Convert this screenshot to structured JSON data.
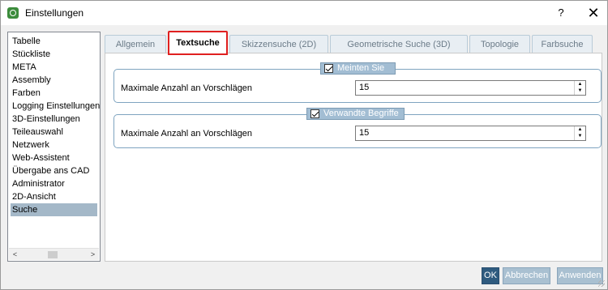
{
  "window": {
    "title": "Einstellungen",
    "help_label": "?",
    "close_label": "✕"
  },
  "sidebar": {
    "items": [
      {
        "label": "Tabelle"
      },
      {
        "label": "Stückliste"
      },
      {
        "label": "META"
      },
      {
        "label": "Assembly"
      },
      {
        "label": "Farben"
      },
      {
        "label": "Logging Einstellungen"
      },
      {
        "label": "3D-Einstellungen"
      },
      {
        "label": "Teileauswahl"
      },
      {
        "label": "Netzwerk"
      },
      {
        "label": "Web-Assistent"
      },
      {
        "label": "Übergabe ans CAD"
      },
      {
        "label": "Administrator"
      },
      {
        "label": "2D-Ansicht"
      },
      {
        "label": "Suche"
      }
    ],
    "selected": "Suche",
    "scroll_left": "<",
    "scroll_right": ">"
  },
  "tabs": [
    {
      "label": "Allgemein"
    },
    {
      "label": "Textsuche"
    },
    {
      "label": "Skizzensuche (2D)"
    },
    {
      "label": "Geometrische Suche (3D)"
    },
    {
      "label": "Topologie"
    },
    {
      "label": "Farbsuche"
    }
  ],
  "active_tab": "Textsuche",
  "groups": {
    "meinten_sie": {
      "title": "Meinten Sie",
      "checked": true,
      "field_label": "Maximale Anzahl an Vorschlägen",
      "value": "15"
    },
    "verwandte_begriffe": {
      "title": "Verwandte Begriffe",
      "checked": true,
      "field_label": "Maximale Anzahl an Vorschlägen",
      "value": "15"
    }
  },
  "buttons": {
    "ok": "OK",
    "cancel": "Abbrechen",
    "apply": "Anwenden"
  },
  "colors": {
    "active_tab_highlight": "#e02020",
    "selection": "#a4b8c8",
    "ok_button": "#2f5b7f",
    "group_header": "#a2bdd3"
  }
}
